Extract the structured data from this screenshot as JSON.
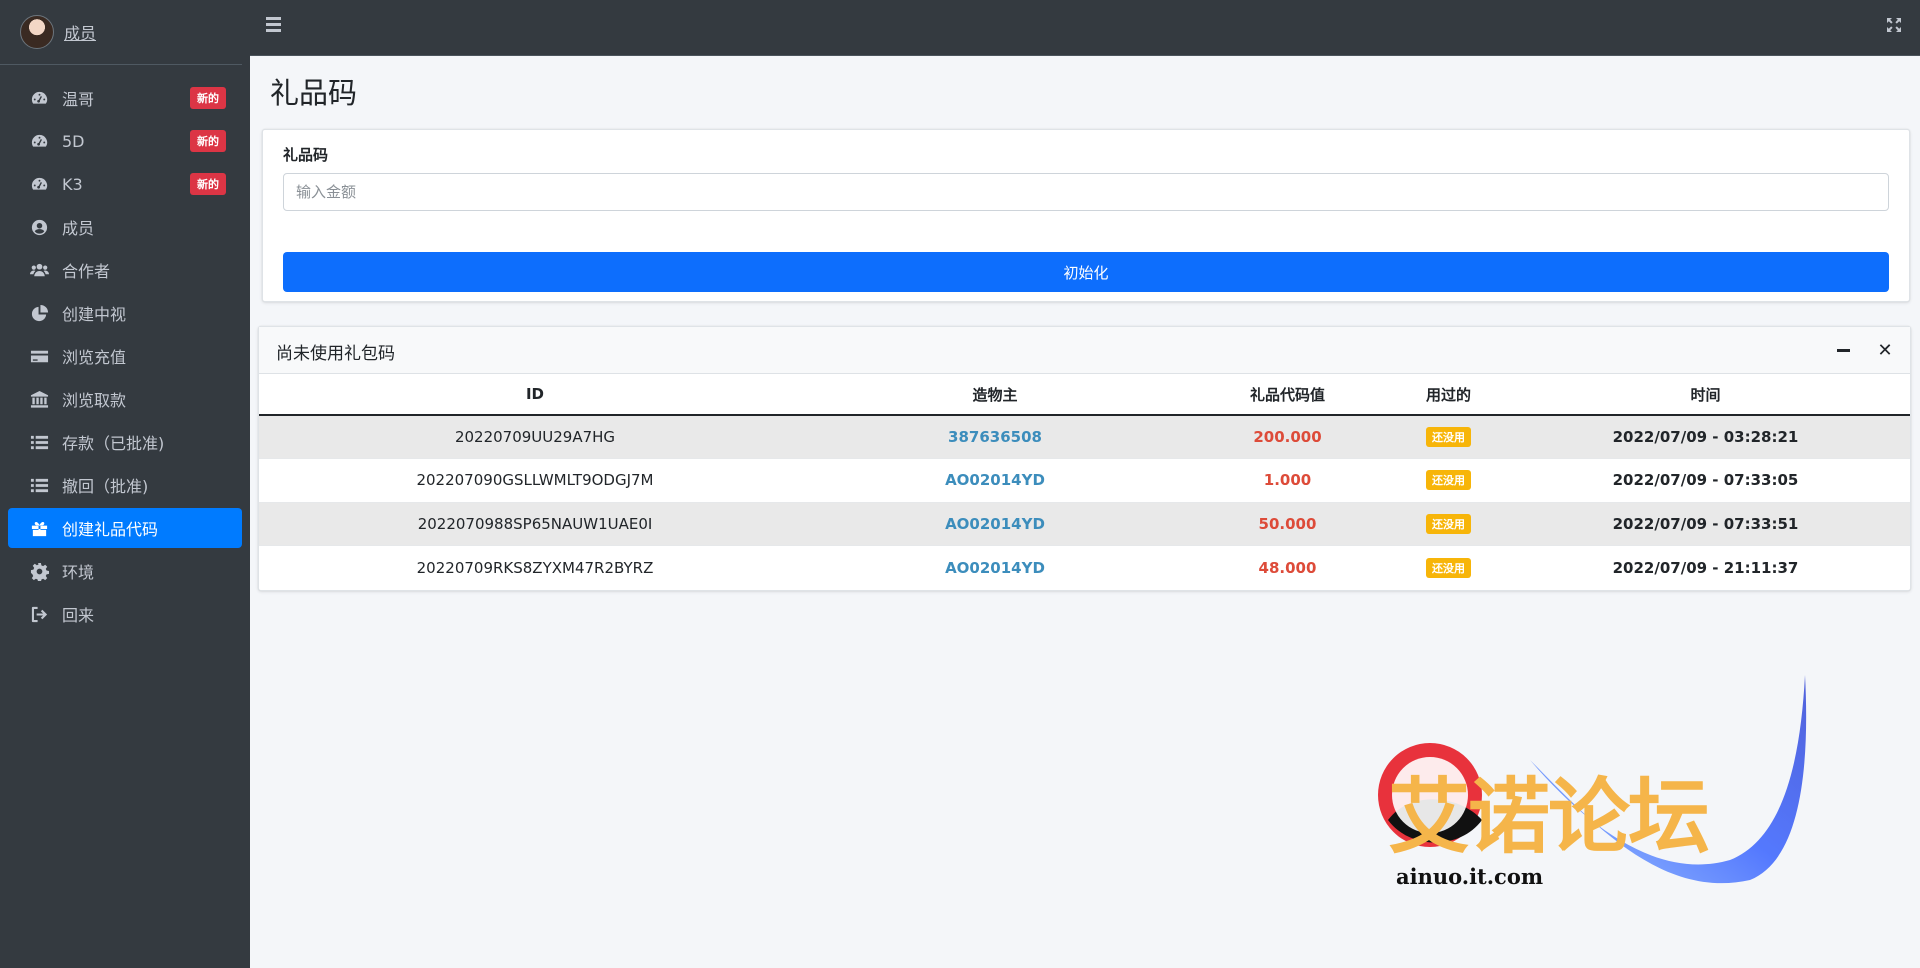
{
  "sidebar": {
    "user_name": "成员",
    "items": [
      {
        "label": "温哥",
        "badge": "新的",
        "icon": "tachometer-icon"
      },
      {
        "label": "5D",
        "badge": "新的",
        "icon": "tachometer-icon"
      },
      {
        "label": "K3",
        "badge": "新的",
        "icon": "tachometer-icon"
      },
      {
        "label": "成员",
        "icon": "user-circle-icon"
      },
      {
        "label": "合作者",
        "icon": "users-icon"
      },
      {
        "label": "创建中视",
        "icon": "pie-chart-icon"
      },
      {
        "label": "浏览充值",
        "icon": "credit-card-icon"
      },
      {
        "label": "浏览取款",
        "icon": "bank-icon"
      },
      {
        "label": "存款（已批准)",
        "icon": "list-icon"
      },
      {
        "label": "撤回（批准)",
        "icon": "list-icon"
      },
      {
        "label": "创建礼品代码",
        "icon": "gift-icon",
        "active": true
      },
      {
        "label": "环境",
        "icon": "gear-icon"
      },
      {
        "label": "回来",
        "icon": "sign-out-icon"
      }
    ]
  },
  "page": {
    "title": "礼品码"
  },
  "form": {
    "label": "礼品码",
    "placeholder": "输入金额",
    "submit_label": "初始化"
  },
  "table_card": {
    "title": "尚未使用礼包码",
    "columns": [
      "ID",
      "造物主",
      "礼品代码值",
      "用过的",
      "时间"
    ],
    "rows": [
      {
        "id": "20220709UU29A7HG",
        "creator": "387636508",
        "value": "200.000",
        "used": "还没用",
        "time": "2022/07/09 - 03:28:21"
      },
      {
        "id": "202207090GSLLWMLT9ODGJ7M",
        "creator": "AO02014YD",
        "value": "1.000",
        "used": "还没用",
        "time": "2022/07/09 - 07:33:05"
      },
      {
        "id": "2022070988SP65NAUW1UAE0I",
        "creator": "AO02014YD",
        "value": "50.000",
        "used": "还没用",
        "time": "2022/07/09 - 07:33:51"
      },
      {
        "id": "20220709RKS8ZYXM47R2BYRZ",
        "creator": "AO02014YD",
        "value": "48.000",
        "used": "还没用",
        "time": "2022/07/09 - 21:11:37"
      }
    ]
  },
  "watermark": {
    "text": "艾诺论坛",
    "url": "ainuo.it.com"
  },
  "colors": {
    "sidebar_bg": "#343a40",
    "active": "#007bff",
    "primary_button": "#0d6efd",
    "badge_new": "#dc3545",
    "badge_unused": "#f7b509",
    "creator": "#3c8dbc",
    "value": "#dd4b39"
  }
}
